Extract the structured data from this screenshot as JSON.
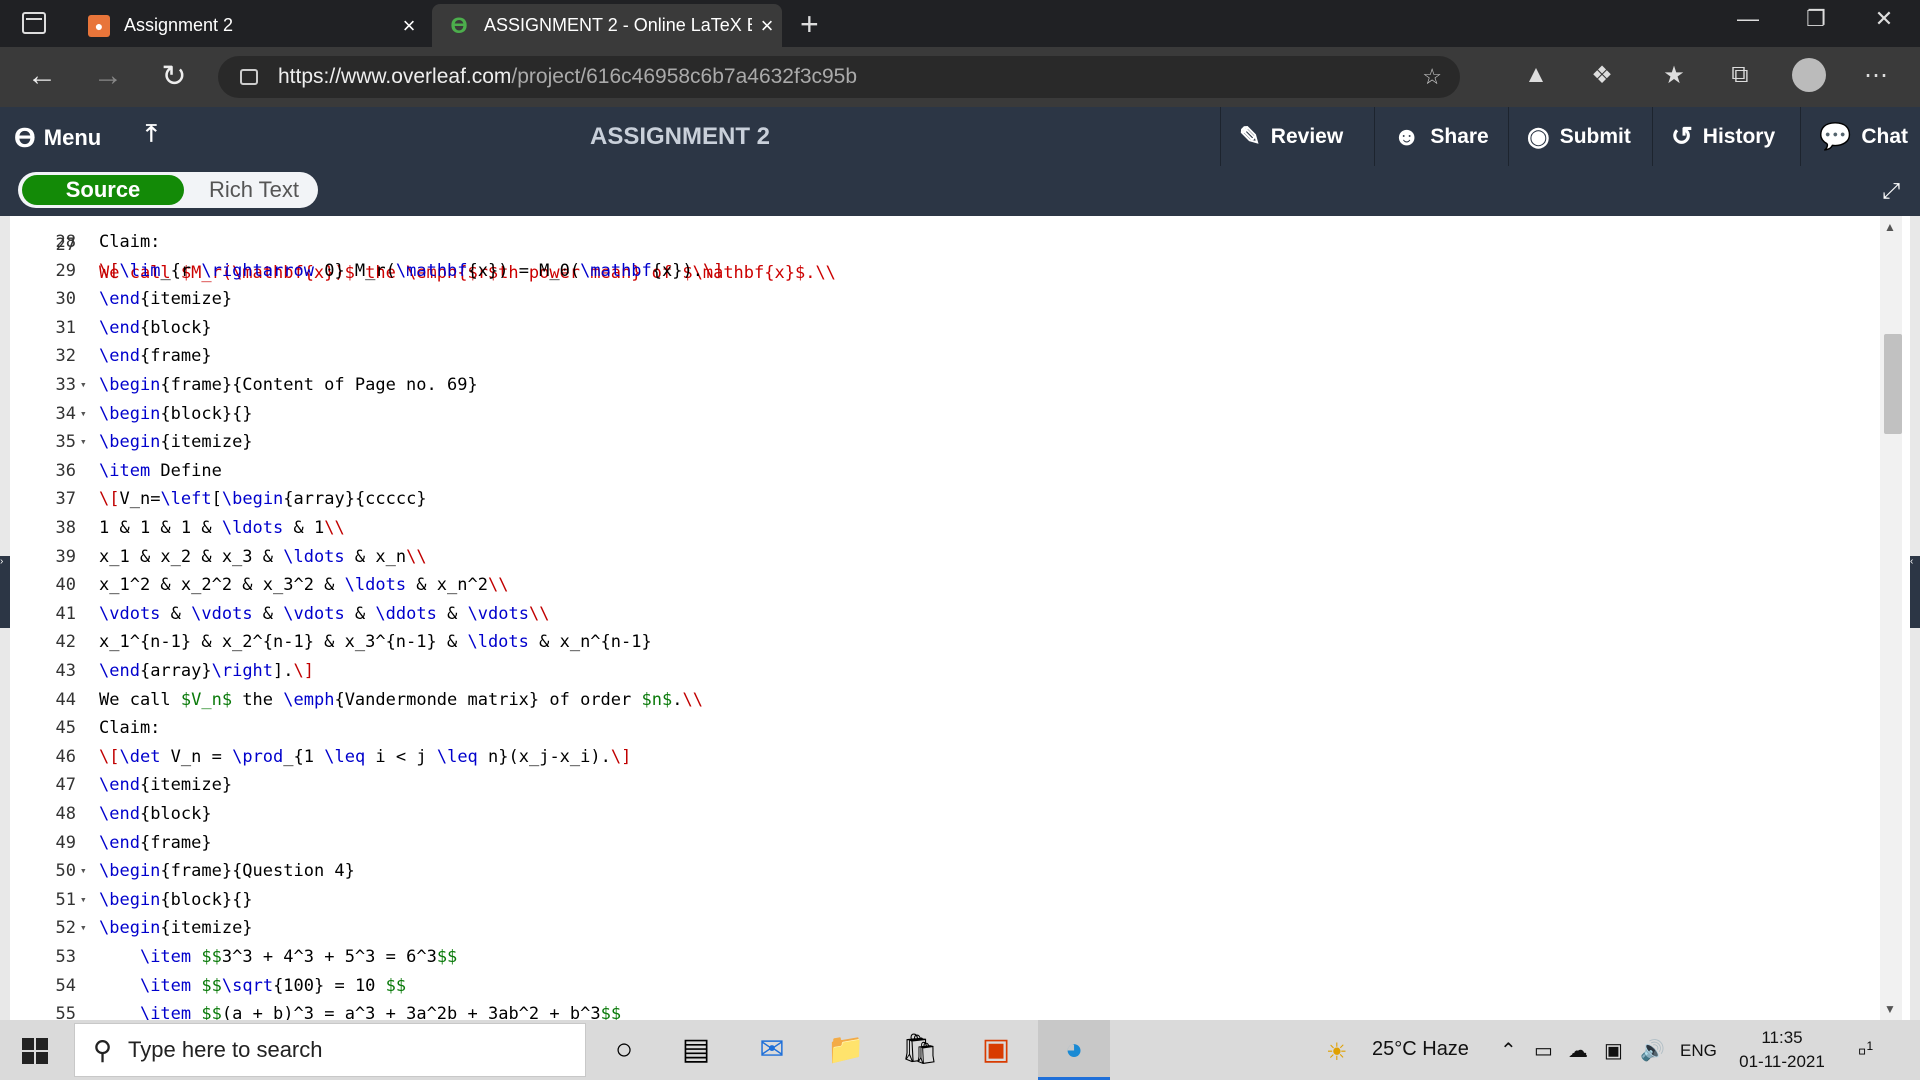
{
  "browser": {
    "tabs": [
      {
        "title": "Assignment 2",
        "active": false
      },
      {
        "title": "ASSIGNMENT 2 - Online LaTeX E",
        "active": true
      }
    ],
    "url_host": "https://www.overleaf.com",
    "url_path": "/project/616c46958c6b7a4632f3c95b"
  },
  "toolbar": {
    "menu_label": "Menu",
    "project_title": "ASSIGNMENT 2",
    "review_label": "Review",
    "share_label": "Share",
    "submit_label": "Submit",
    "history_label": "History",
    "chat_label": "Chat"
  },
  "mode": {
    "source_label": "Source",
    "rich_label": "Rich Text",
    "selected": "Source"
  },
  "editor": {
    "partial_top_line": "We call $M_r(\\mathbf{x})$ the \\emph{$r$th power mean} of $\\mathbf{x}$.\\\\",
    "lines": [
      {
        "n": "28",
        "fold": false,
        "text": "Claim:"
      },
      {
        "n": "29",
        "fold": false,
        "text": "\\[\\lim_{r \\rightarrow 0} M_r(\\mathbf{x}) = M_0(\\mathbf{x}).\\]"
      },
      {
        "n": "30",
        "fold": false,
        "text": "\\end{itemize}"
      },
      {
        "n": "31",
        "fold": false,
        "text": "\\end{block}"
      },
      {
        "n": "32",
        "fold": false,
        "text": "\\end{frame}"
      },
      {
        "n": "33",
        "fold": true,
        "text": "\\begin{frame}{Content of Page no. 69}"
      },
      {
        "n": "34",
        "fold": true,
        "text": "\\begin{block}{}"
      },
      {
        "n": "35",
        "fold": true,
        "text": "\\begin{itemize}"
      },
      {
        "n": "36",
        "fold": false,
        "text": "\\item Define"
      },
      {
        "n": "37",
        "fold": false,
        "text": "\\[V_n=\\left[\\begin{array}{ccccc}"
      },
      {
        "n": "38",
        "fold": false,
        "text": "1 & 1 & 1 & \\ldots & 1\\\\"
      },
      {
        "n": "39",
        "fold": false,
        "text": "x_1 & x_2 & x_3 & \\ldots & x_n\\\\"
      },
      {
        "n": "40",
        "fold": false,
        "text": "x_1^2 & x_2^2 & x_3^2 & \\ldots & x_n^2\\\\"
      },
      {
        "n": "41",
        "fold": false,
        "text": "\\vdots & \\vdots & \\vdots & \\ddots & \\vdots\\\\"
      },
      {
        "n": "42",
        "fold": false,
        "text": "x_1^{n-1} & x_2^{n-1} & x_3^{n-1} & \\ldots & x_n^{n-1}"
      },
      {
        "n": "43",
        "fold": false,
        "text": "\\end{array}\\right].\\]"
      },
      {
        "n": "44",
        "fold": false,
        "text": "We call $V_n$ the \\emph{Vandermonde matrix} of order $n$.\\\\"
      },
      {
        "n": "45",
        "fold": false,
        "text": "Claim:"
      },
      {
        "n": "46",
        "fold": false,
        "text": "\\[\\det V_n = \\prod_{1 \\leq i < j \\leq n}(x_j-x_i).\\]"
      },
      {
        "n": "47",
        "fold": false,
        "text": "\\end{itemize}"
      },
      {
        "n": "48",
        "fold": false,
        "text": "\\end{block}"
      },
      {
        "n": "49",
        "fold": false,
        "text": "\\end{frame}"
      },
      {
        "n": "50",
        "fold": true,
        "text": "\\begin{frame}{Question 4}"
      },
      {
        "n": "51",
        "fold": true,
        "text": "\\begin{block}{}"
      },
      {
        "n": "52",
        "fold": true,
        "text": "\\begin{itemize}"
      },
      {
        "n": "53",
        "fold": false,
        "text": "    \\item $$3^3 + 4^3 + 5^3 = 6^3$$"
      },
      {
        "n": "54",
        "fold": false,
        "text": "    \\item $$\\sqrt{100} = 10 $$"
      },
      {
        "n": "55",
        "fold": false,
        "text": "    \\item $$(a + b)^3 = a^3 + 3a^2b + 3ab^2 + b^3$$"
      }
    ]
  },
  "taskbar": {
    "search_placeholder": "Type here to search",
    "weather": "25°C  Haze",
    "language": "ENG",
    "time": "11:35",
    "date": "01-11-2021",
    "notification_count": "1"
  },
  "colors": {
    "overleaf_dark": "#2c3645",
    "source_green": "#138a07",
    "keyword_blue": "#0000cc",
    "brace_red": "#c00000",
    "math_green": "#0a7a0a"
  }
}
